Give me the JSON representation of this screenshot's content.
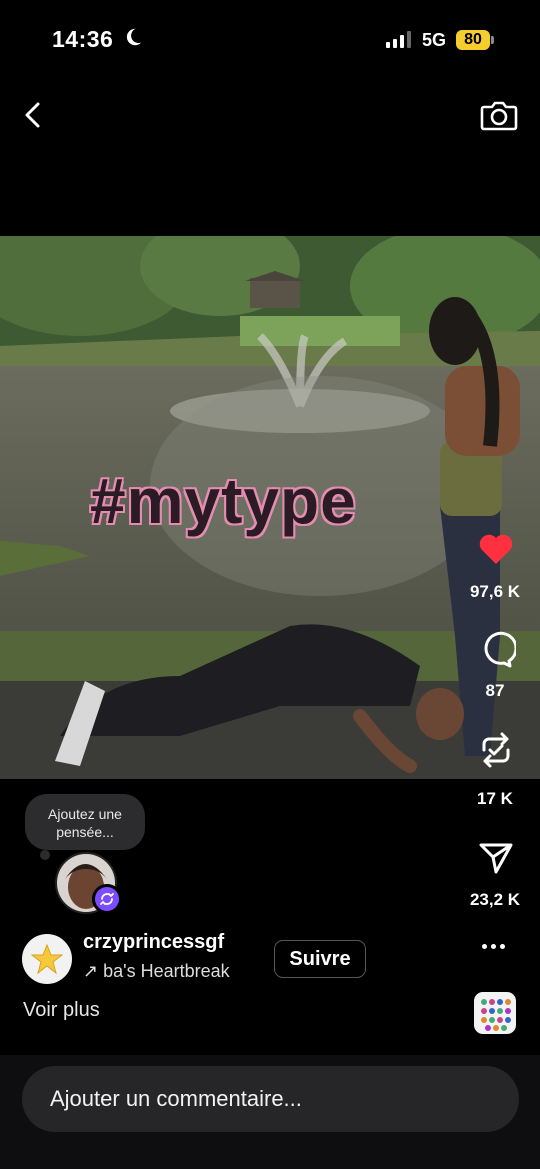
{
  "status_bar": {
    "time": "14:36",
    "network": "5G",
    "battery": "80",
    "icons": [
      "moon-icon",
      "signal-icon",
      "battery-icon"
    ]
  },
  "nav": {
    "back_icon": "chevron-left-icon",
    "camera_icon": "camera-icon"
  },
  "video": {
    "overlay_text": "#mytype"
  },
  "actions": {
    "likes": "97,6 K",
    "comments": "87",
    "reposts": "17 K",
    "shares": "23,2 K",
    "like_color": "#ff3040"
  },
  "thought_bubble": {
    "text": "Ajoutez une pensée..."
  },
  "post": {
    "username": "crzyprincessgf",
    "audio": "ba's Heartbreak",
    "follow_label": "Suivre",
    "see_more": "Voir plus"
  },
  "comment": {
    "placeholder": "Ajouter un commentaire..."
  },
  "colors": {
    "background": "#000000",
    "accent": "#7c4dff",
    "battery": "#f5cd2d"
  }
}
